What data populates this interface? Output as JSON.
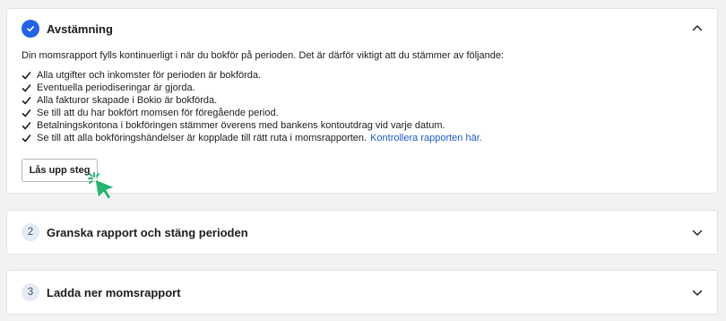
{
  "steps": [
    {
      "title": "Avstämning",
      "status": "completed",
      "expanded": true,
      "intro": "Din momsrapport fylls kontinuerligt i när du bokför på perioden. Det är därför viktigt att du stämmer av följande:",
      "checklist": [
        "Alla utgifter och inkomster för perioden är bokförda.",
        "Eventuella periodiseringar är gjorda.",
        "Alla fakturor skapade i Bokio är bokförda.",
        "Se till att du har bokfört momsen för föregående period.",
        "Betalningskontona i bokföringen stämmer överens med bankens kontoutdrag vid varje datum.",
        "Se till att alla bokföringshändelser är kopplade till rätt ruta i momsrapporten."
      ],
      "link_text": "Kontrollera rapporten här.",
      "button_label": "Lås upp steg"
    },
    {
      "number": "2",
      "title": "Granska rapport och stäng perioden",
      "expanded": false
    },
    {
      "number": "3",
      "title": "Ladda ner momsrapport",
      "expanded": false
    }
  ],
  "icons": {
    "completed": "check-icon",
    "collapse": "chevron-up-icon",
    "expand": "chevron-down-icon",
    "cursor": "pointer-cursor-icon"
  },
  "colors": {
    "accent": "#2563e6",
    "link": "#1d5ad1",
    "cursor": "#22b573",
    "step_badge_bg": "#e6eaf4",
    "page_bg": "#f2f2f3"
  }
}
